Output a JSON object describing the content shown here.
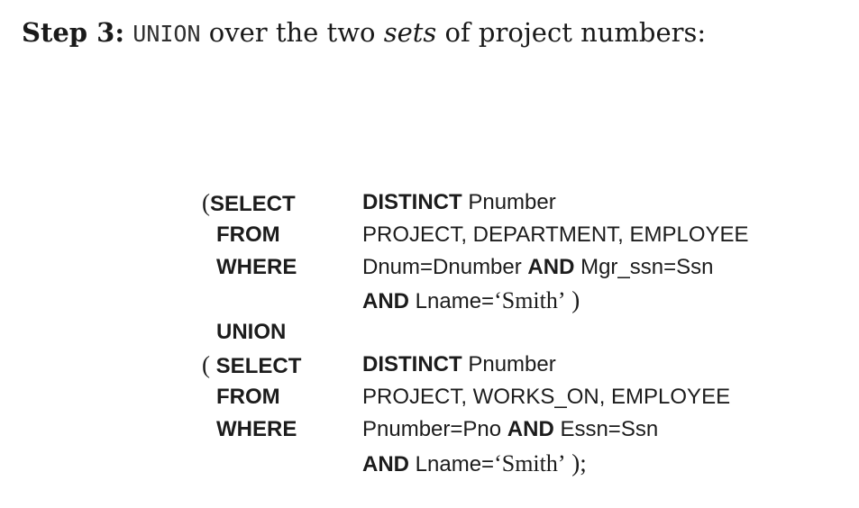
{
  "heading": {
    "step_label": "Step 3:",
    "keyword": "UNION",
    "text_before_em": "over the two",
    "emphasis": "sets",
    "text_after_em": "of project numbers:"
  },
  "query": {
    "block1": {
      "open_paren": "(",
      "select_kw": "SELECT",
      "distinct_kw": "DISTINCT",
      "select_attr": "Pnumber",
      "from_kw": "FROM",
      "from_tables": "PROJECT, DEPARTMENT, EMPLOYEE",
      "where_kw": "WHERE",
      "cond1": "Dnum=Dnumber",
      "and_kw1": "AND",
      "cond2": "Mgr_ssn=Ssn",
      "and_kw2": "AND",
      "cond3_attr": "Lname=",
      "cond3_literal": "‘Smith’",
      "close": " )"
    },
    "union_kw": "UNION",
    "block2": {
      "open_paren": "(",
      "select_kw": "SELECT",
      "distinct_kw": "DISTINCT",
      "select_attr": "Pnumber",
      "from_kw": "FROM",
      "from_tables": "PROJECT, WORKS_ON, EMPLOYEE",
      "where_kw": "WHERE",
      "cond1": "Pnumber=Pno",
      "and_kw1": "AND",
      "cond2": "Essn=Ssn",
      "and_kw2": "AND",
      "cond3_attr": "Lname=",
      "cond3_literal": "‘Smith’",
      "close": " );"
    }
  }
}
